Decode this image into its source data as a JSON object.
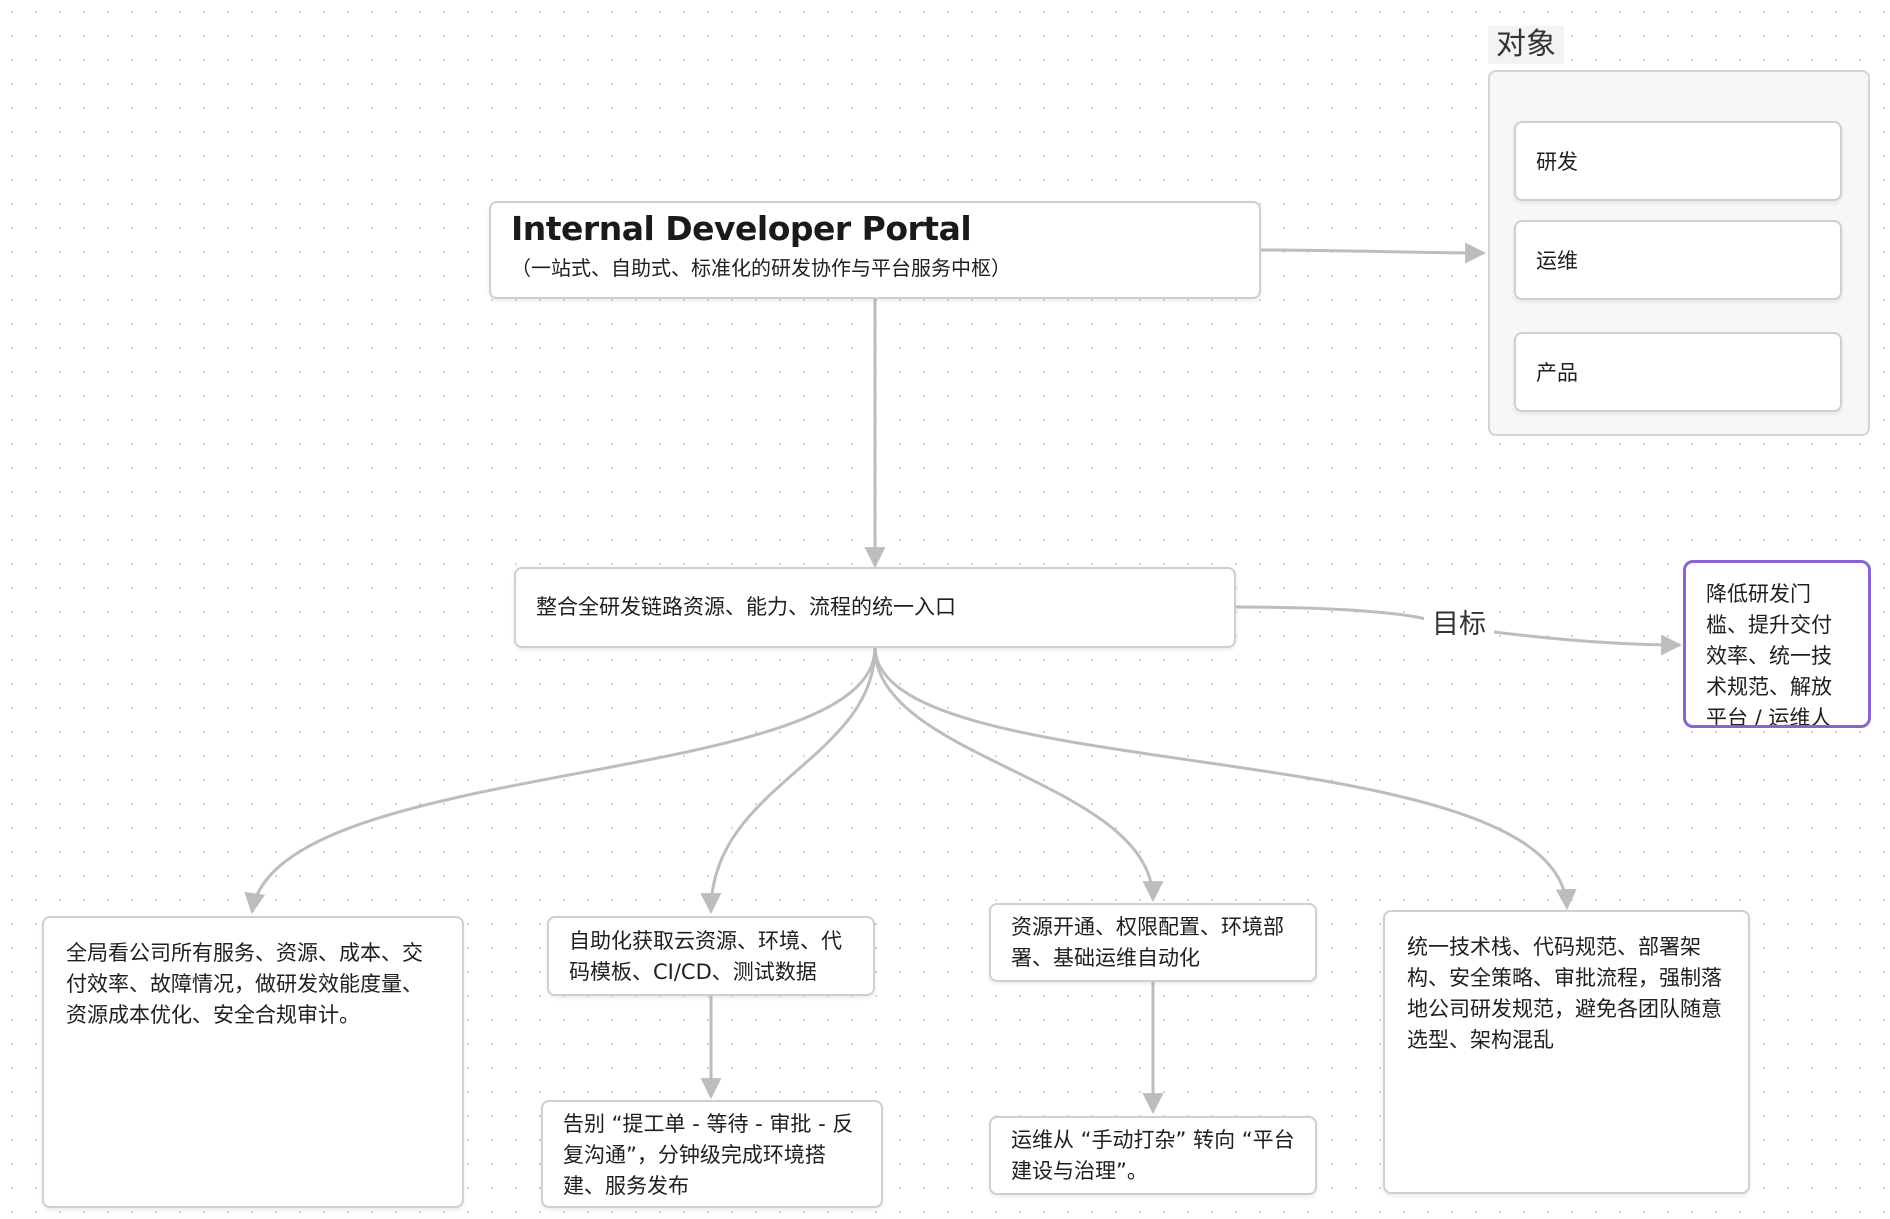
{
  "portal": {
    "title": "Internal Developer Portal",
    "subtitle": "（一站式、自助式、标准化的研发协作与平台服务中枢）"
  },
  "audience_group": {
    "label": "对象",
    "items": [
      "研发",
      "运维",
      "产品"
    ]
  },
  "hub": {
    "text": "整合全研发链路资源、能力、流程的统一入口"
  },
  "goal_edge_label": "目标",
  "goal": {
    "text": "降低研发门槛、提升交付效率、统一技术规范、解放平台 / 运维人"
  },
  "branches": {
    "overview": "全局看公司所有服务、资源、成本、交付效率、故障情况，做研发效能度量、资源成本优化、安全合规审计。",
    "self_service": "自助化获取云资源、环境、代码模板、CI/CD、测试数据",
    "self_service_result": "告别 “提工单 - 等待 - 审批 - 反复沟通”，分钟级完成环境搭建、服务发布",
    "ops_automation": "资源开通、权限配置、环境部署、基础运维自动化",
    "ops_automation_result": "运维从 “手动打杂” 转向 “平台建设与治理”。",
    "standards": "统一技术栈、代码规范、部署架构、安全策略、审批流程，强制落地公司研发规范，避免各团队随意选型、架构混乱"
  },
  "colors": {
    "connector": "#bdbdbd",
    "node_border": "#cfcfcf",
    "goal_border": "#8a63d2",
    "group_background": "#f6f6f6"
  }
}
